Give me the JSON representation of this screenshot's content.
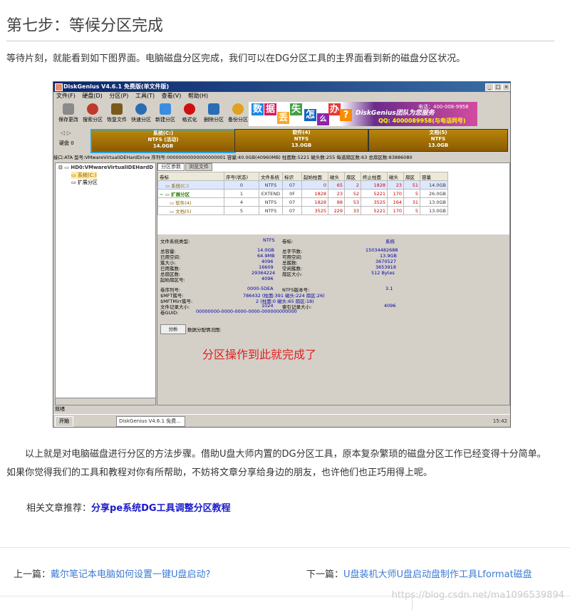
{
  "article": {
    "heading": "第七步：等候分区完成",
    "intro": "等待片刻，就能看到如下图界面。电脑磁盘分区完成，我们可以在DG分区工具的主界面看到新的磁盘分区状况。",
    "para": "以上就是对电脑磁盘进行分区的方法步骤。借助U盘大师内置的DG分区工具，原本复杂繁琐的磁盘分区工作已经变得十分简单。如果你觉得我们的工具和教程对你有所帮助，不妨将文章分享给身边的朋友，也许他们也正巧用得上呢。",
    "related_label": "相关文章推荐：",
    "related_link": "分享pe系统DG工具调整分区教程",
    "prev_label": "上一篇：",
    "prev_link": "戴尔笔记本电脑如何设置一键U盘启动?",
    "next_label": "下一篇：",
    "next_link": "U盘装机大师U盘启动盘制作工具Lformat磁盘",
    "watermark": "https://blog.csdn.net/ma1096539894"
  },
  "app": {
    "title": "DiskGenius V4.6.1 免费版(单文件版)",
    "menu": [
      "文件(F)",
      "硬盘(D)",
      "分区(P)",
      "工具(T)",
      "查看(V)",
      "帮助(H)"
    ],
    "toolbar": [
      {
        "label": "保存更改",
        "color": "#8a8a8a"
      },
      {
        "label": "搜索分区",
        "color": "#c0392b"
      },
      {
        "label": "恢复文件",
        "color": "#7a5a1a"
      },
      {
        "label": "快速分区",
        "color": "#2a6db5"
      },
      {
        "label": "新建分区",
        "color": "#3a8de0"
      },
      {
        "label": "格式化",
        "color": "#d01010"
      },
      {
        "label": "删除分区",
        "color": "#2a6db5"
      },
      {
        "label": "备份分区",
        "color": "#e0a020"
      }
    ],
    "ad": {
      "chars": [
        "数",
        "据",
        "丢",
        "失",
        "怎",
        "么",
        "办",
        "?"
      ],
      "slogan": "DiskGenius团队为您服务",
      "qq": "QQ: 4000089958(与电话同号)",
      "tel": "电话：400-008-9958"
    },
    "disk_label": "硬盘 0",
    "partitions": [
      {
        "name": "系统(C:)",
        "fs": "NTFS (活动)",
        "size": "14.0GB"
      },
      {
        "name": "软件(4)",
        "fs": "NTFS",
        "size": "13.0GB"
      },
      {
        "name": "文档(5)",
        "fs": "NTFS",
        "size": "13.0GB"
      }
    ],
    "infobar": "接口:ATA  型号:VMwareVirtualIDEHardDrive  序列号:00000000000000000001  容量:40.0GB(40960MB)  柱面数:5221  磁头数:255  每道扇区数:63  总扇区数:83886080",
    "tree": {
      "disk": "HD0:VMwareVirtualIDEHardD",
      "items": [
        "系统(C:)",
        "扩展分区"
      ]
    },
    "tabs": [
      "分区参数",
      "浏览文件"
    ],
    "columns": [
      "卷标",
      "序号(状态)",
      "文件系统",
      "标识",
      "起始柱面",
      "磁头",
      "扇区",
      "终止柱面",
      "磁头",
      "扇区",
      "容量"
    ],
    "rows": [
      [
        "系统(C:)",
        "0",
        "NTFS",
        "07",
        "0",
        "65",
        "2",
        "1828",
        "23",
        "51",
        "14.0GB"
      ],
      [
        "扩展分区",
        "1",
        "EXTEND",
        "0F",
        "1828",
        "23",
        "52",
        "5221",
        "170",
        "5",
        "26.0GB"
      ],
      [
        "软件(4)",
        "4",
        "NTFS",
        "07",
        "1828",
        "88",
        "53",
        "3525",
        "164",
        "31",
        "13.0GB"
      ],
      [
        "文档(5)",
        "5",
        "NTFS",
        "07",
        "3525",
        "229",
        "33",
        "5221",
        "170",
        "5",
        "13.0GB"
      ]
    ],
    "details": {
      "fs_type_label": "文件系统类型:",
      "fs_type": "NTFS",
      "vol_label": "卷标:",
      "vol": "系统",
      "total_label": "总容量:",
      "total": "14.0GB",
      "total_bytes_label": "总字节数:",
      "total_bytes": "15034482688",
      "used_label": "已用空间:",
      "used": "64.9MB",
      "free_label": "可用空间:",
      "free": "13.9GB",
      "cluster_label": "簇大小:",
      "cluster": "4096",
      "clusters_label": "总簇数:",
      "clusters": "3670527",
      "used_clusters_label": "已用簇数:",
      "used_clusters": "16609",
      "free_clusters_label": "空闲簇数:",
      "free_clusters": "3653918",
      "sectors_label": "总扇区数:",
      "sectors": "29364224",
      "sector_size_label": "扇区大小:",
      "sector_size": "512 Bytes",
      "start_label": "起始扇区号:",
      "start": "4096",
      "serial_label": "卷序列号:",
      "serial": "0000-5DEA",
      "ntfs_ver_label": "NTFS版本号:",
      "ntfs_ver": "3.1",
      "mft_label": "$MFT簇号:",
      "mft": "786432 (柱面:391 磁头:224 扇区:26)",
      "mftmirr_label": "$MFTMirr簇号:",
      "mftmirr": "2 (柱面:0 磁头:65 扇区:18)",
      "rec_label": "文件记录大小:",
      "rec": "1024",
      "idx_label": "索引记录大小:",
      "idx": "4096",
      "guid_label": "卷GUID:",
      "guid": "00000000-0000-0000-0000-000000000000"
    },
    "analyze_button": "分析",
    "analyze_caption": "数据分配情况图:",
    "done_text": "分区操作到此就完成了",
    "status": "就绪",
    "taskbar": {
      "start": "开始",
      "item": "DiskGenius V4.6.1 免费...",
      "clock": "15:42"
    }
  }
}
